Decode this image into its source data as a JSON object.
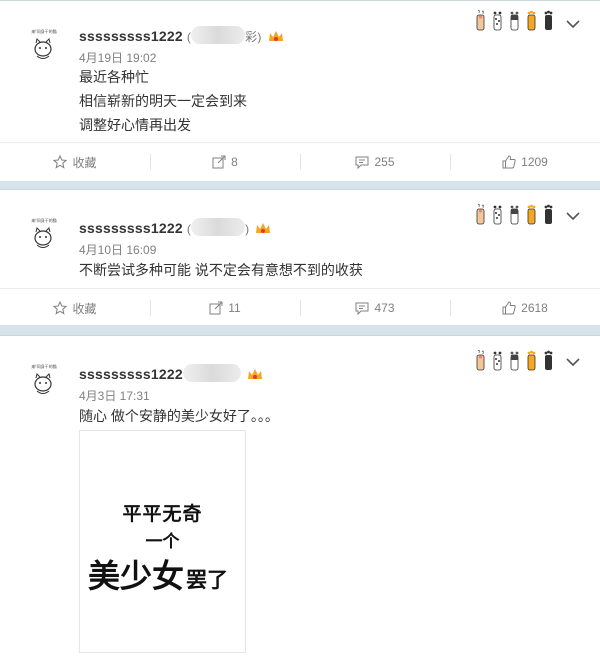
{
  "posts": [
    {
      "username": "sssssssss1222",
      "handle_suffix": "彩",
      "time": "4月19日 19:02",
      "lines": [
        "最近各种忙",
        "相信崭新的明天一定会到来",
        "调整好心情再出发"
      ],
      "actions": {
        "favorite_label": "收藏",
        "repost_count": "8",
        "comment_count": "255",
        "like_count": "1209"
      }
    },
    {
      "username": "sssssssss1222",
      "handle_suffix": "",
      "time": "4月10日 16:09",
      "lines": [
        "不断尝试多种可能 说不定会有意想不到的收获"
      ],
      "actions": {
        "favorite_label": "收藏",
        "repost_count": "11",
        "comment_count": "473",
        "like_count": "2618"
      }
    },
    {
      "username": "sssssssss1222",
      "handle_suffix": "",
      "time": "4月3日 17:31",
      "lines": [
        "随心 做个安静的美少女好了。。。"
      ],
      "image": {
        "line1": "平平无奇",
        "line2": "一个",
        "line3_big": "美少女",
        "line3_small": "罢了"
      }
    }
  ],
  "colors": {
    "accent_orange": "#f6a623",
    "icon_gray": "#808080",
    "page_bg": "#d6e3ea"
  },
  "icons": [
    "cat-avatar-icon",
    "crown-icon",
    "paw-icon",
    "chevron-down-icon",
    "star-icon",
    "repost-icon",
    "comment-icon",
    "like-icon"
  ]
}
